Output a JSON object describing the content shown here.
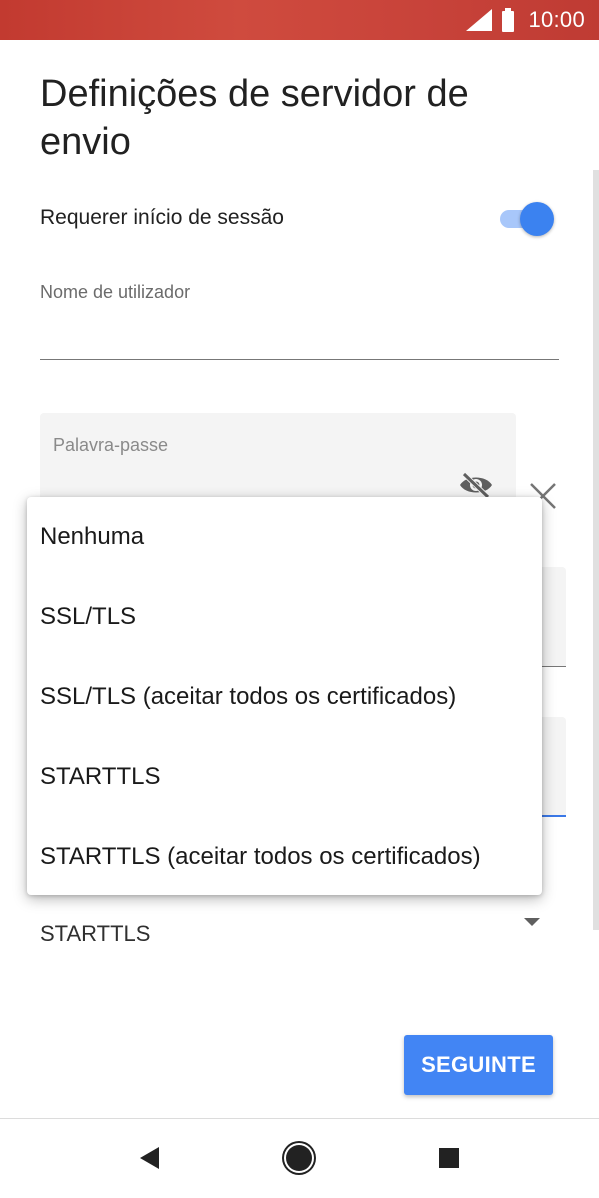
{
  "status_bar": {
    "time": "10:00",
    "signal_icon": "cellular-signal-icon",
    "battery_icon": "battery-full-icon",
    "color": "#c8433a"
  },
  "page": {
    "title": "Definições de servidor de envio"
  },
  "signin": {
    "label": "Requerer início de sessão",
    "toggle_on": true,
    "accent": "#3b82f0"
  },
  "username": {
    "label": "Nome de utilizador",
    "value": ""
  },
  "password": {
    "label": "Palavra-passe",
    "value": "",
    "visibility_icon": "eye-off-icon",
    "clear_icon": "close-icon"
  },
  "security": {
    "selected": "STARTTLS",
    "options": [
      "Nenhuma",
      "SSL/TLS",
      "SSL/TLS (aceitar todos os certificados)",
      "STARTTLS",
      "STARTTLS (aceitar todos os certificados)"
    ]
  },
  "actions": {
    "next_label": "SEGUINTE",
    "next_color": "#4285f4"
  },
  "nav": {
    "back_icon": "back-triangle-icon",
    "home_icon": "home-circle-icon",
    "recents_icon": "recents-square-icon"
  }
}
